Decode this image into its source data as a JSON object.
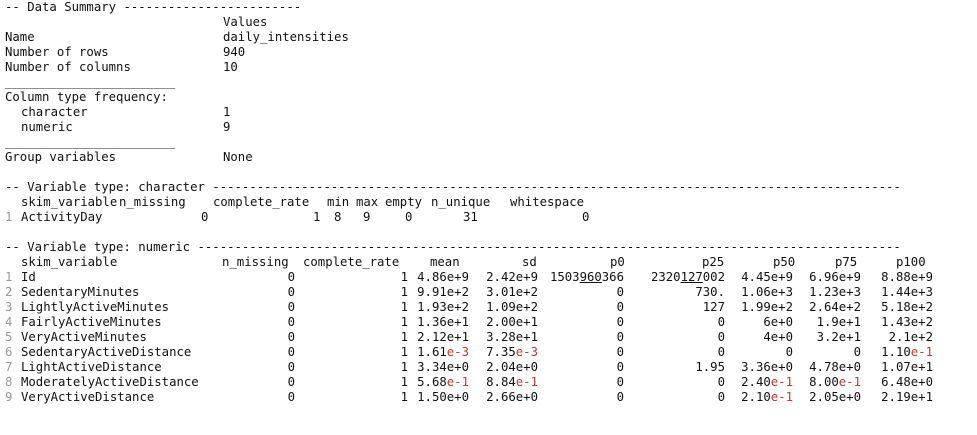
{
  "summary": {
    "header": "-- Data Summary ------------------------",
    "values_header": "Values",
    "rows": [
      {
        "label": "Name",
        "value": "daily_intensities"
      },
      {
        "label": "Number of rows",
        "value": "940"
      },
      {
        "label": "Number of columns",
        "value": "10"
      }
    ],
    "separator": "_______________________",
    "col_type_label": "Column type frequency:",
    "col_types": [
      {
        "label": "character",
        "value": "1"
      },
      {
        "label": "numeric",
        "value": "9"
      }
    ],
    "group_label": "Group variables",
    "group_value": "None"
  },
  "character": {
    "header": "-- Variable type: character ---------------------------------------------------------------------------------------------",
    "columns": [
      "skim_variable",
      "n_missing",
      "complete_rate",
      "min",
      "max",
      "empty",
      "n_unique",
      "whitespace"
    ],
    "rows": [
      {
        "idx": "1",
        "name": "ActivityDay",
        "n_missing": "0",
        "complete_rate": "1",
        "min": "8",
        "max": "9",
        "empty": "0",
        "n_unique": "31",
        "whitespace": "0"
      }
    ]
  },
  "numeric": {
    "header": "-- Variable type: numeric -----------------------------------------------------------------------------------------------",
    "columns": [
      "skim_variable",
      "n_missing",
      "complete_rate",
      "mean",
      "sd",
      "p0",
      "p25",
      "p50",
      "p75",
      "p100"
    ],
    "rows": [
      {
        "idx": "1",
        "name": "Id",
        "n_missing": "0",
        "complete_rate": "1",
        "mean": {
          "m": "4.86",
          "e": "e+9"
        },
        "sd": {
          "m": "2.42",
          "e": "e+9"
        },
        "p0": {
          "a": "1503",
          "b": "960",
          "c": "366"
        },
        "p25": {
          "a": "2320",
          "b": "127",
          "c": "002"
        },
        "p50": {
          "m": "4.45",
          "e": "e+9"
        },
        "p75": {
          "m": "6.96",
          "e": "e+9"
        },
        "p100": {
          "m": "8.88",
          "e": "e+9"
        }
      },
      {
        "idx": "2",
        "name": "SedentaryMinutes",
        "n_missing": "0",
        "complete_rate": "1",
        "mean": {
          "m": "9.91",
          "e": "e+2"
        },
        "sd": {
          "m": "3.01",
          "e": "e+2"
        },
        "p0": "0",
        "p25": "730.",
        "p50": {
          "m": "1.06",
          "e": "e+3"
        },
        "p75": {
          "m": "1.23",
          "e": "e+3"
        },
        "p100": {
          "m": "1.44",
          "e": "e+3"
        }
      },
      {
        "idx": "3",
        "name": "LightlyActiveMinutes",
        "n_missing": "0",
        "complete_rate": "1",
        "mean": {
          "m": "1.93",
          "e": "e+2"
        },
        "sd": {
          "m": "1.09",
          "e": "e+2"
        },
        "p0": "0",
        "p25": "127",
        "p50": {
          "m": "1.99",
          "e": "e+2"
        },
        "p75": {
          "m": "2.64",
          "e": "e+2"
        },
        "p100": {
          "m": "5.18",
          "e": "e+2"
        }
      },
      {
        "idx": "4",
        "name": "FairlyActiveMinutes",
        "n_missing": "0",
        "complete_rate": "1",
        "mean": {
          "m": "1.36",
          "e": "e+1"
        },
        "sd": {
          "m": "2.00",
          "e": "e+1"
        },
        "p0": "0",
        "p25": "0",
        "p50": {
          "m": "6",
          "e": "e+0"
        },
        "p75": {
          "m": "1.9",
          "e": "e+1"
        },
        "p100": {
          "m": "1.43",
          "e": "e+2"
        }
      },
      {
        "idx": "5",
        "name": "VeryActiveMinutes",
        "n_missing": "0",
        "complete_rate": "1",
        "mean": {
          "m": "2.12",
          "e": "e+1"
        },
        "sd": {
          "m": "3.28",
          "e": "e+1"
        },
        "p0": "0",
        "p25": "0",
        "p50": {
          "m": "4",
          "e": "e+0"
        },
        "p75": {
          "m": "3.2",
          "e": "e+1"
        },
        "p100": {
          "m": "2.1",
          "e": "e+2"
        }
      },
      {
        "idx": "6",
        "name": "SedentaryActiveDistance",
        "n_missing": "0",
        "complete_rate": "1",
        "mean": {
          "m": "1.61",
          "e": "e-3"
        },
        "sd": {
          "m": "7.35",
          "e": "e-3"
        },
        "p0": "0",
        "p25": "0",
        "p50": "0",
        "p75": "0",
        "p100": {
          "m": "1.10",
          "e": "e-1"
        }
      },
      {
        "idx": "7",
        "name": "LightActiveDistance",
        "n_missing": "0",
        "complete_rate": "1",
        "mean": {
          "m": "3.34",
          "e": "e+0"
        },
        "sd": {
          "m": "2.04",
          "e": "e+0"
        },
        "p0": "0",
        "p25": "1.95",
        "p50": {
          "m": "3.36",
          "e": "e+0"
        },
        "p75": {
          "m": "4.78",
          "e": "e+0"
        },
        "p100": {
          "m": "1.07",
          "e": "e+1"
        }
      },
      {
        "idx": "8",
        "name": "ModeratelyActiveDistance",
        "n_missing": "0",
        "complete_rate": "1",
        "mean": {
          "m": "5.68",
          "e": "e-1"
        },
        "sd": {
          "m": "8.84",
          "e": "e-1"
        },
        "p0": "0",
        "p25": "0",
        "p50": {
          "m": "2.40",
          "e": "e-1"
        },
        "p75": {
          "m": "8.00",
          "e": "e-1"
        },
        "p100": {
          "m": "6.48",
          "e": "e+0"
        }
      },
      {
        "idx": "9",
        "name": "VeryActiveDistance",
        "n_missing": "0",
        "complete_rate": "1",
        "mean": {
          "m": "1.50",
          "e": "e+0"
        },
        "sd": {
          "m": "2.66",
          "e": "e+0"
        },
        "p0": "0",
        "p25": "0",
        "p50": {
          "m": "2.10",
          "e": "e-1"
        },
        "p75": {
          "m": "2.05",
          "e": "e+0"
        },
        "p100": {
          "m": "2.19",
          "e": "e+1"
        }
      }
    ]
  },
  "colors": {
    "negative_exponent": "#c0392b",
    "row_index": "#9a9a9a",
    "text": "#111111"
  }
}
